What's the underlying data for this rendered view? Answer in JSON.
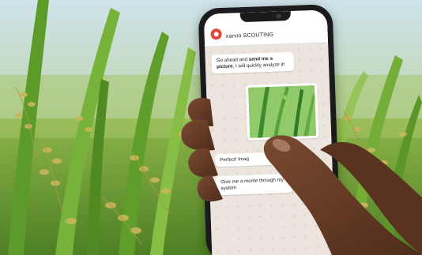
{
  "chat": {
    "contact_name": "xarvio SCOUTING",
    "message_1_lead": "Go ahead and ",
    "message_1_bold": "send me a picture",
    "message_1_tail": ", I will quickly analyze it!",
    "message_2": "Perfect! Imag",
    "message_3": "Give me a mome through my system"
  },
  "colors": {
    "accent": "#e0463b",
    "chat_background": "#ece5dd",
    "field_green": "#6fa83a"
  }
}
